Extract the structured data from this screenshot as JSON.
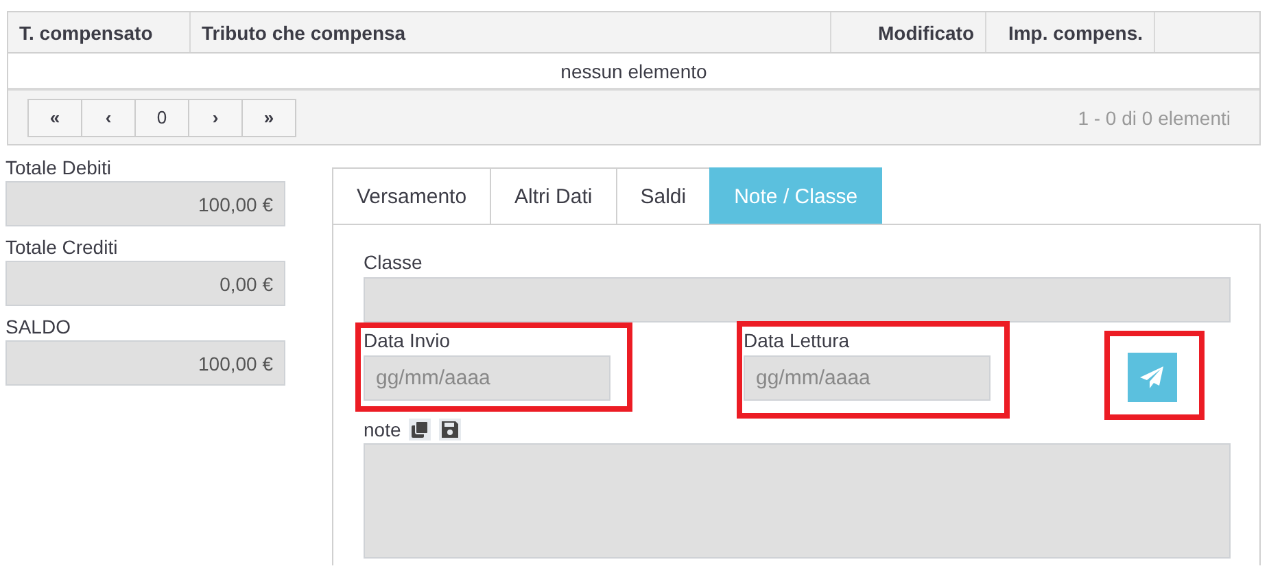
{
  "table": {
    "columns": [
      "T. compensato",
      "Tributo che compensa",
      "Modificato",
      "Imp. compens."
    ],
    "empty_message": "nessun elemento",
    "pager": {
      "buttons": [
        "«",
        "‹",
        "0",
        "›",
        "»"
      ],
      "summary": "1 - 0 di 0 elementi"
    }
  },
  "totals": [
    {
      "label": "Totale Debiti",
      "value": "100,00 €"
    },
    {
      "label": "Totale Crediti",
      "value": "0,00 €"
    },
    {
      "label": "SALDO",
      "value": "100,00 €"
    }
  ],
  "tabs": [
    {
      "label": "Versamento",
      "selected": false
    },
    {
      "label": "Altri Dati",
      "selected": false
    },
    {
      "label": "Saldi",
      "selected": false
    },
    {
      "label": "Note / Classe",
      "selected": true
    }
  ],
  "form": {
    "classe": {
      "label": "Classe"
    },
    "data_invio": {
      "label": "Data Invio",
      "placeholder": "gg/mm/aaaa",
      "highlighted": true
    },
    "data_lettura": {
      "label": "Data Lettura",
      "placeholder": "gg/mm/aaaa",
      "highlighted": true
    },
    "send_button": {
      "highlighted": true
    },
    "note": {
      "label": "note"
    }
  }
}
